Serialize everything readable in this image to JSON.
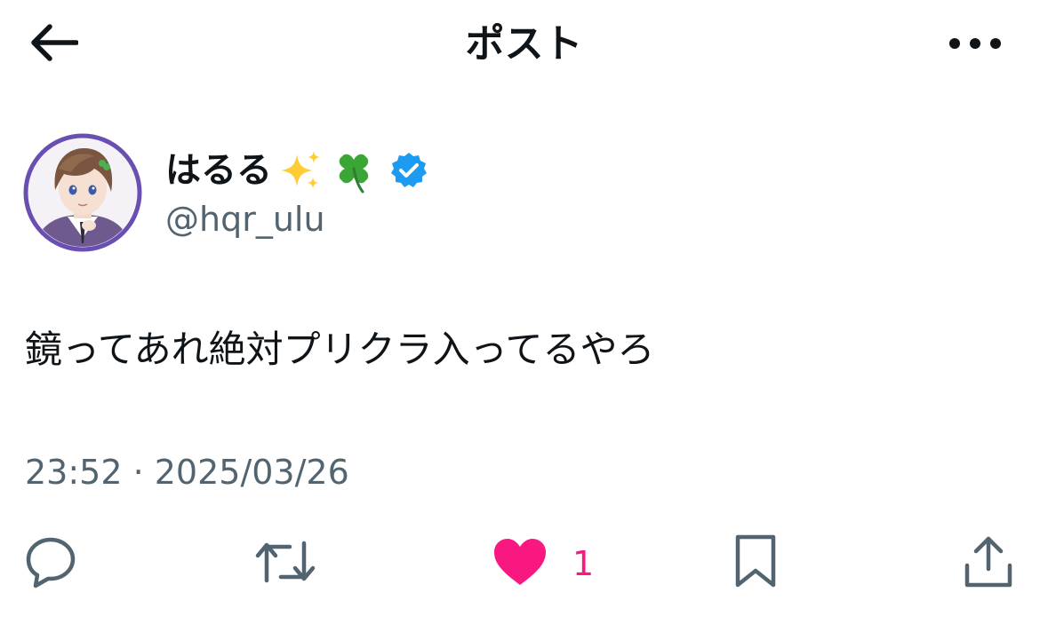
{
  "header": {
    "title": "ポスト",
    "back_icon": "arrow-left-icon",
    "more_icon": "more-horizontal-icon"
  },
  "author": {
    "display_name": "はるる",
    "name_emojis": [
      "sparkles-icon",
      "four-leaf-clover-icon"
    ],
    "verified": true,
    "handle": "@hqr_ulu",
    "avatar_ring_color": "#6a4fb3"
  },
  "post": {
    "text": "鏡ってあれ絶対プリクラ入ってるやろ",
    "timestamp": "23:52 · 2025/03/26"
  },
  "actions": {
    "reply_icon": "reply-icon",
    "repost_icon": "repost-icon",
    "like_icon": "heart-filled-icon",
    "like_count": "1",
    "like_color": "#f91880",
    "bookmark_icon": "bookmark-icon",
    "share_icon": "share-icon"
  },
  "colors": {
    "text_primary": "#0f1419",
    "text_secondary": "#536471",
    "verified_badge": "#1d9bf0"
  }
}
